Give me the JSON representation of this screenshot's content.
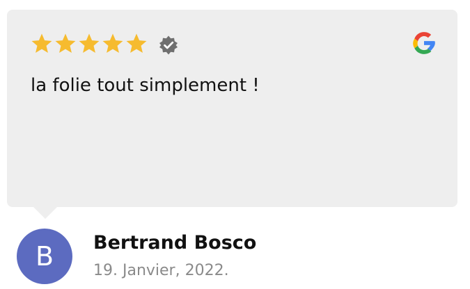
{
  "review": {
    "rating": 5,
    "rating_max": 5,
    "text": "la folie tout simplement !",
    "verified_icon": "verified-badge-icon",
    "source_icon": "google-icon"
  },
  "reviewer": {
    "initial": "B",
    "name": "Bertrand Bosco",
    "date": "19. Janvier, 2022."
  },
  "colors": {
    "card_background": "#eeeeee",
    "star": "#f6bb2f",
    "verified_badge": "#6f6f6f",
    "avatar_background": "#5c6bc0",
    "name": "#111111",
    "date": "#8a8a8a",
    "google_blue": "#4285f4",
    "google_red": "#ea4335",
    "google_yellow": "#fbbc05",
    "google_green": "#34a853"
  }
}
